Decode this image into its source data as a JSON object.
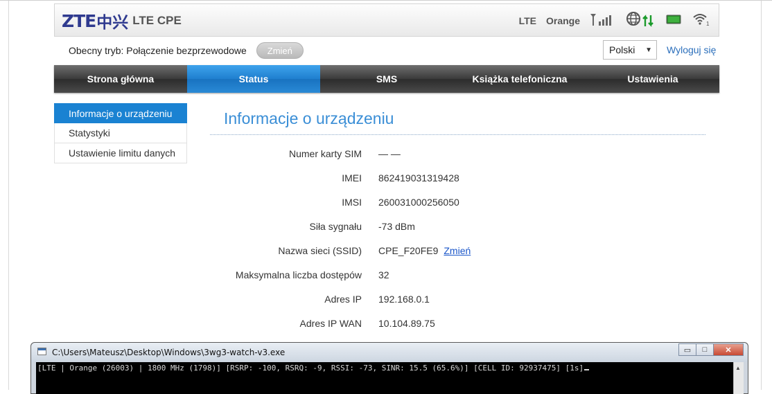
{
  "header": {
    "logo_zte": "ZTE",
    "logo_cn": "中兴",
    "logo_sub": "LTE CPE",
    "network_type": "LTE",
    "operator": "Orange",
    "icons": [
      "signal-icon",
      "globe-icon",
      "data-arrows-icon",
      "battery-icon",
      "wifi-icon"
    ],
    "wifi_clients": "1"
  },
  "mode": {
    "label": "Obecny tryb: Połączenie bezprzewodowe",
    "change_button": "Zmień"
  },
  "language": {
    "selected": "Polski"
  },
  "logout_label": "Wyloguj się",
  "nav": {
    "items": [
      {
        "label": "Strona główna"
      },
      {
        "label": "Status"
      },
      {
        "label": "SMS"
      },
      {
        "label": "Książka telefoniczna"
      },
      {
        "label": "Ustawienia"
      }
    ],
    "active_index": 1
  },
  "left_menu": {
    "items": [
      {
        "label": "Informacje o urządzeniu"
      },
      {
        "label": "Statystyki"
      },
      {
        "label": "Ustawienie limitu danych"
      }
    ],
    "active_index": 0
  },
  "content": {
    "title": "Informacje o urządzeniu",
    "rows": [
      {
        "label": "Numer karty SIM",
        "value": "— —"
      },
      {
        "label": "IMEI",
        "value": "862419031319428"
      },
      {
        "label": "IMSI",
        "value": "260031000256050"
      },
      {
        "label": "Siła sygnału",
        "value": "-73 dBm"
      },
      {
        "label": "Nazwa sieci (SSID)",
        "value": "CPE_F20FE9",
        "link": "Zmień"
      },
      {
        "label": "Maksymalna liczba dostępów",
        "value": "32"
      },
      {
        "label": "Adres IP",
        "value": "192.168.0.1"
      },
      {
        "label": "Adres IP WAN",
        "value": "10.104.89.75"
      }
    ]
  },
  "console": {
    "title": "C:\\Users\\Mateusz\\Desktop\\Windows\\3wg3-watch-v3.exe",
    "line": "[LTE | Orange (26003) | 1800 MHz (1798)] [RSRP: -100, RSRQ: -9, RSSI: -73, SINR: 15.5 (65.6%)] [CELL ID: 92937475] [1s]",
    "minimize_glyph": "▭",
    "maximize_glyph": "□",
    "close_glyph": "✕"
  },
  "colors": {
    "accent": "#1a82d2",
    "title": "#3a8ed6",
    "link": "#1a56c9",
    "logo": "#2f3a8f"
  }
}
